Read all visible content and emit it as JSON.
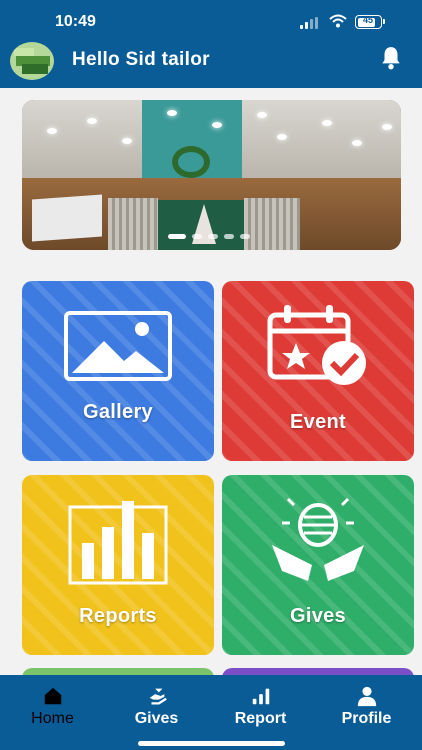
{
  "status_bar": {
    "time": "10:49",
    "battery_level": "45"
  },
  "header": {
    "greeting": "Hello Sid tailor",
    "icons": [
      "avatar",
      "bell-icon"
    ]
  },
  "banner": {
    "carousel_dots": 5,
    "active_dot": 1
  },
  "tiles": [
    {
      "label": "Gallery",
      "icon": "image-icon",
      "color": "#3d7be0"
    },
    {
      "label": "Event",
      "icon": "calendar-check-icon",
      "color": "#de3b36"
    },
    {
      "label": "Reports",
      "icon": "bar-chart-icon",
      "color": "#f1c21c"
    },
    {
      "label": "Gives",
      "icon": "giving-hands-icon",
      "color": "#2fae69"
    }
  ],
  "bottom_nav": {
    "items": [
      {
        "label": "Home",
        "icon": "home-icon",
        "active": true
      },
      {
        "label": "Gives",
        "icon": "hand-heart-icon",
        "active": false
      },
      {
        "label": "Report",
        "icon": "bar-chart-icon",
        "active": false
      },
      {
        "label": "Profile",
        "icon": "person-icon",
        "active": false
      }
    ]
  },
  "colors": {
    "primary": "#0a5c96",
    "active_nav_label": "#000000"
  }
}
